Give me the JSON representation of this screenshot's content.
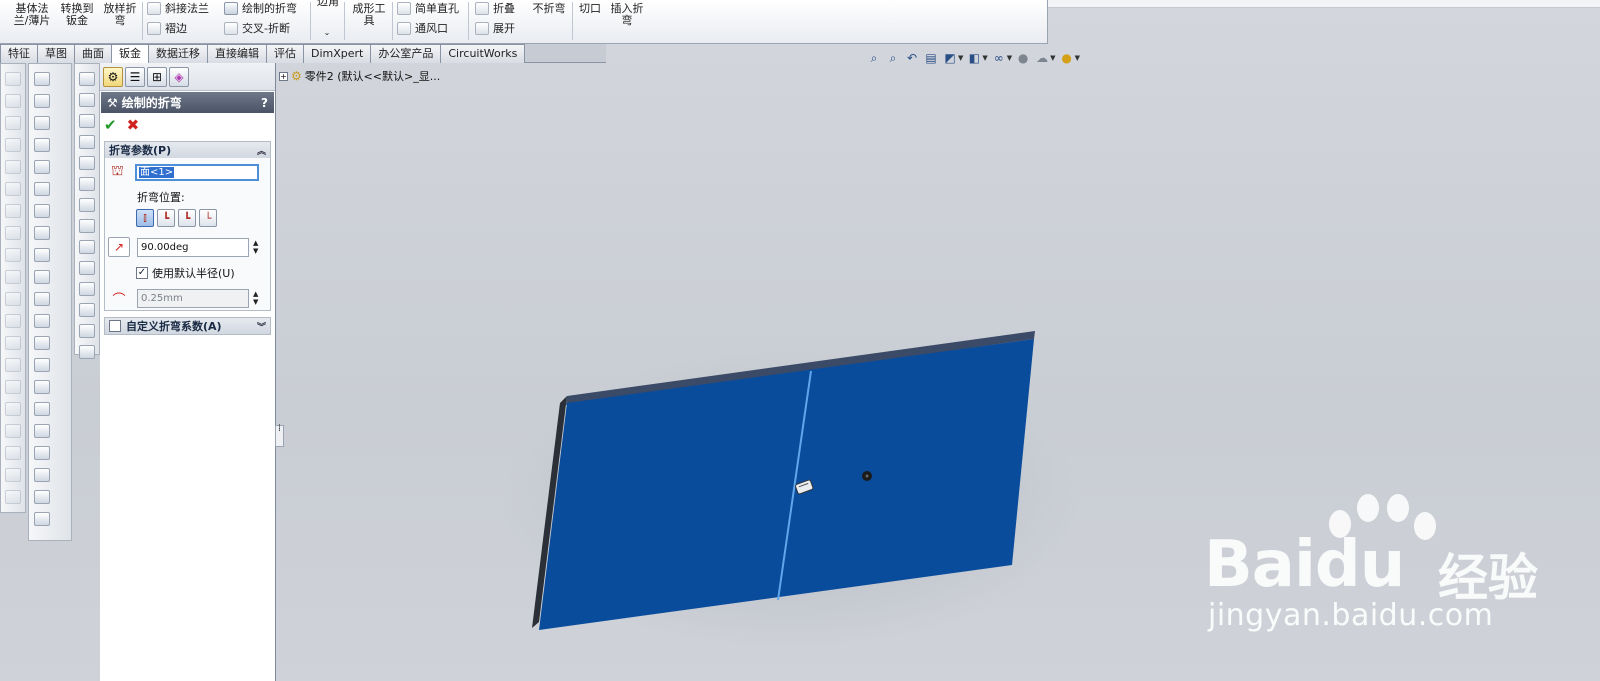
{
  "ribbon": {
    "base_flange": "基体法\n兰/薄片",
    "convert_to_sheet": "转换到\n钣金",
    "lofted_bend": "放样折\n弯",
    "miter_flange": "斜接法兰",
    "hem": "褶边",
    "sketched_bend": "绘制的折弯",
    "cross_break": "交叉-折断",
    "corners": "边角",
    "forming_tool": "成形工\n具",
    "simple_hole": "简单直孔",
    "vent": "通风口",
    "fold": "折叠",
    "unfold": "展开",
    "no_bends": "不折弯",
    "cut": "切口",
    "insert_bends": "插入折\n弯"
  },
  "tabs": [
    "特征",
    "草图",
    "曲面",
    "钣金",
    "数据迁移",
    "直接编辑",
    "评估",
    "DimXpert",
    "办公室产品",
    "CircuitWorks"
  ],
  "active_tab_index": 3,
  "property_manager": {
    "title": "绘制的折弯",
    "help": "?",
    "ok_symbol": "✔",
    "cancel_symbol": "✖",
    "params_group": {
      "title": "折弯参数(P)",
      "face_value": "面<1>",
      "position_label": "折弯位置:",
      "angle_value": "90.00deg",
      "use_default_radius_label": "使用默认半径(U)",
      "use_default_radius_checked": true,
      "radius_value": "0.25mm"
    },
    "custom_group": {
      "title": "自定义折弯系数(A)",
      "checked": false
    }
  },
  "feature_tree": {
    "root_label": "零件2  (默认<<默认>_显..."
  },
  "watermark": {
    "brand": "Bai",
    "brand_tail": "du",
    "cn": "经验",
    "url": "jingyan.baidu.com"
  },
  "colors": {
    "sheet_face": "#0a4c9c",
    "sheet_edge": "#2a2f38",
    "bend_line": "#5fa6ea"
  }
}
